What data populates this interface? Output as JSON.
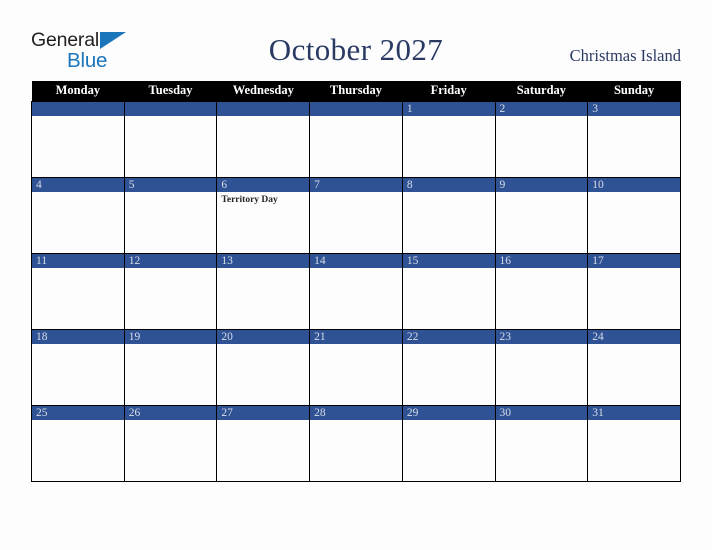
{
  "brand": {
    "logo_primary": "General",
    "logo_secondary": "Blue",
    "logo_triangle_icon": "blue-triangle-icon",
    "primary_color": "#231f20",
    "secondary_color": "#1b75bb"
  },
  "header": {
    "title": "October 2027",
    "location": "Christmas Island",
    "title_color": "#2a3a63"
  },
  "calendar": {
    "month": "October",
    "year": "2027",
    "header_background": "#000000",
    "daybar_background": "#2f5294",
    "day_number_color": "#d8dde8",
    "weekday_headers": [
      "Monday",
      "Tuesday",
      "Wednesday",
      "Thursday",
      "Friday",
      "Saturday",
      "Sunday"
    ],
    "weeks": [
      [
        {
          "day": "",
          "events": []
        },
        {
          "day": "",
          "events": []
        },
        {
          "day": "",
          "events": []
        },
        {
          "day": "",
          "events": []
        },
        {
          "day": "1",
          "events": []
        },
        {
          "day": "2",
          "events": []
        },
        {
          "day": "3",
          "events": []
        }
      ],
      [
        {
          "day": "4",
          "events": []
        },
        {
          "day": "5",
          "events": []
        },
        {
          "day": "6",
          "events": [
            "Territory Day"
          ]
        },
        {
          "day": "7",
          "events": []
        },
        {
          "day": "8",
          "events": []
        },
        {
          "day": "9",
          "events": []
        },
        {
          "day": "10",
          "events": []
        }
      ],
      [
        {
          "day": "11",
          "events": []
        },
        {
          "day": "12",
          "events": []
        },
        {
          "day": "13",
          "events": []
        },
        {
          "day": "14",
          "events": []
        },
        {
          "day": "15",
          "events": []
        },
        {
          "day": "16",
          "events": []
        },
        {
          "day": "17",
          "events": []
        }
      ],
      [
        {
          "day": "18",
          "events": []
        },
        {
          "day": "19",
          "events": []
        },
        {
          "day": "20",
          "events": []
        },
        {
          "day": "21",
          "events": []
        },
        {
          "day": "22",
          "events": []
        },
        {
          "day": "23",
          "events": []
        },
        {
          "day": "24",
          "events": []
        }
      ],
      [
        {
          "day": "25",
          "events": []
        },
        {
          "day": "26",
          "events": []
        },
        {
          "day": "27",
          "events": []
        },
        {
          "day": "28",
          "events": []
        },
        {
          "day": "29",
          "events": []
        },
        {
          "day": "30",
          "events": []
        },
        {
          "day": "31",
          "events": []
        }
      ]
    ]
  }
}
